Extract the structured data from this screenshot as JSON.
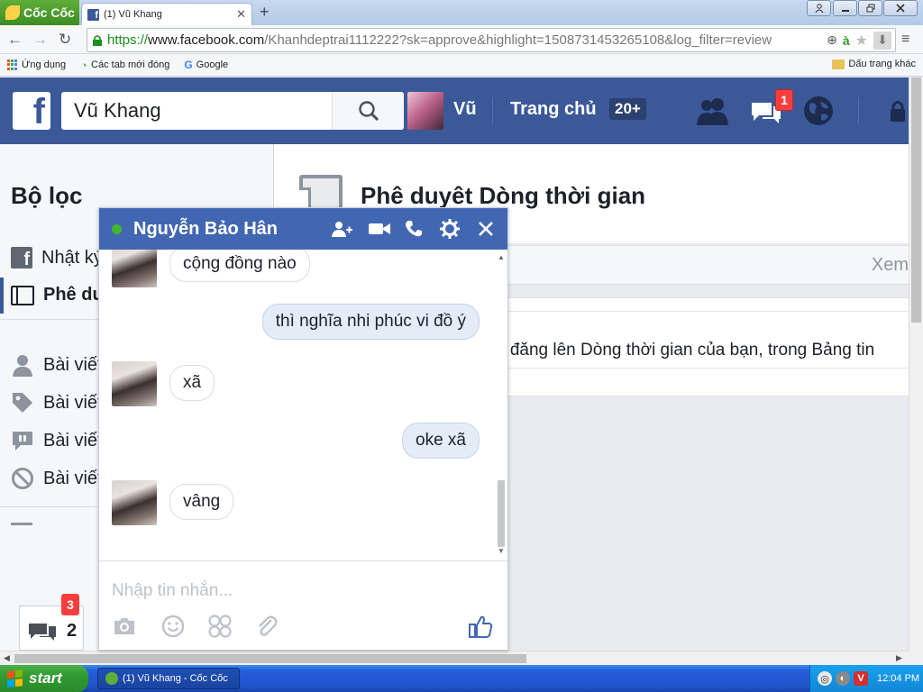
{
  "browser": {
    "brand": "Cốc Cốc",
    "tab_title": "(1) Vũ Khang",
    "url_scheme": "https://",
    "url_host": "www.facebook.com",
    "url_rest": "/Khanhdeptrai1112222?sk=approve&highlight=1508731453265108&log_filter=review",
    "bookmarks": {
      "apps": "Ứng dụng",
      "recent_tabs": "Các tab mới đóng",
      "google": "Google",
      "other": "Dấu trang khác"
    }
  },
  "facebook": {
    "search_value": "Vũ Khang",
    "user_name": "Vũ",
    "home_label": "Trang chủ",
    "home_count": "20+",
    "messages_badge": "1",
    "left": {
      "title": "Bộ lọc",
      "items": [
        {
          "label": "Nhật ký hoạt động"
        },
        {
          "label": "Phê duyệt Dòng thời gian"
        },
        {
          "label": "Bài viết bạn đã đăng"
        },
        {
          "label": "Bài viết bạn được gắn thẻ"
        },
        {
          "label": "Bài viết của người khác"
        },
        {
          "label": "Bài viết bạn đã ẩn"
        }
      ]
    },
    "main": {
      "title": "Phê duyêt Dòng thời gian",
      "view_link": "Xem",
      "info_text": "o đăng lên Dòng thời gian của bạn, trong Bảng tin"
    }
  },
  "chat": {
    "contact_name": "Nguyễn Bảo Hân",
    "messages": [
      {
        "direction": "in",
        "text": "cộng đồng nào"
      },
      {
        "direction": "out",
        "text": "thì nghĩa nhi phúc vi đồ ý"
      },
      {
        "direction": "in",
        "text": "xã"
      },
      {
        "direction": "out",
        "text": "oke xã"
      },
      {
        "direction": "in",
        "text": "vâng"
      }
    ],
    "input_placeholder": "Nhập tin nhắn..."
  },
  "chat_tab": {
    "count": "2",
    "badge": "3"
  },
  "taskbar": {
    "start_label": "start",
    "task_label": "(1) Vũ Khang - Cốc Cốc",
    "clock": "12:04 PM"
  },
  "colors": {
    "facebook_blue": "#3b5998",
    "messenger_header": "#4267b2",
    "badge_red": "#fa3e3e",
    "online_green": "#42b72a"
  }
}
